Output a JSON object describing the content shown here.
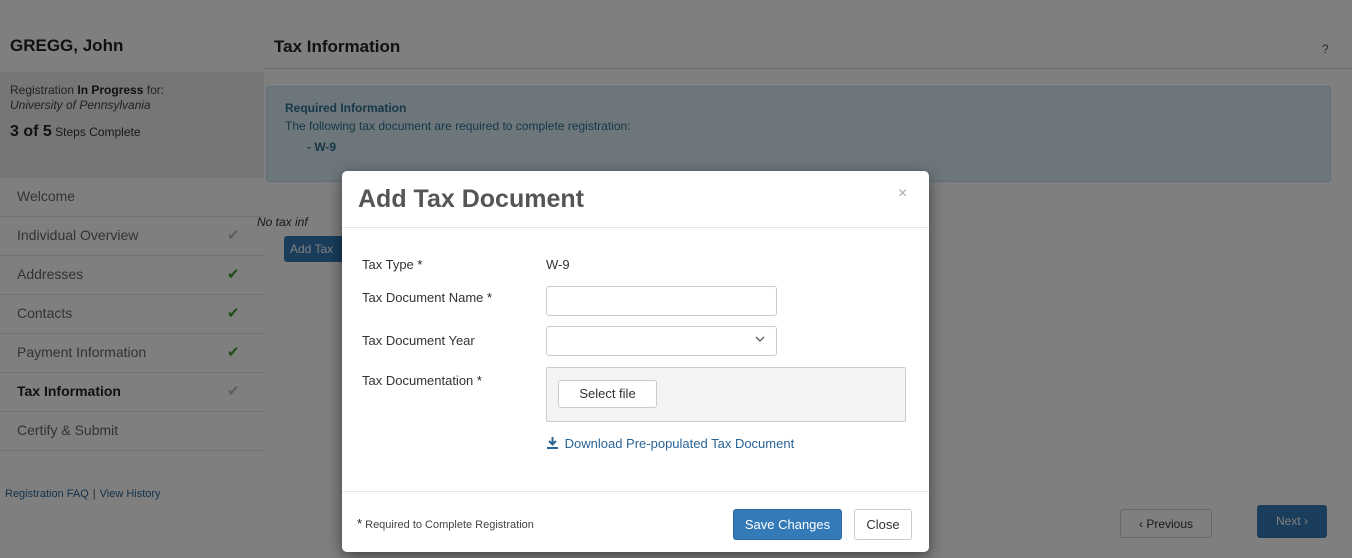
{
  "sidebar": {
    "user_name": "GREGG, John",
    "status_prefix": "Registration ",
    "status_bold": "In Progress",
    "status_suffix": " for:",
    "organization": "University of Pennsylvania",
    "progress_big": "3 of 5",
    "progress_small": " Steps Complete",
    "steps": [
      {
        "label": "Welcome",
        "check": ""
      },
      {
        "label": "Individual Overview",
        "check": "✔"
      },
      {
        "label": "Addresses",
        "check": "✔"
      },
      {
        "label": "Contacts",
        "check": "✔"
      },
      {
        "label": "Payment Information",
        "check": "✔"
      },
      {
        "label": "Tax Information",
        "check": "✔"
      },
      {
        "label": "Certify & Submit",
        "check": ""
      }
    ],
    "link_faq": "Registration FAQ",
    "link_sep": "|",
    "link_history": "View History"
  },
  "main": {
    "title": "Tax Information",
    "help": "?",
    "alert_heading": "Required Information",
    "alert_text": "The following tax document are required to complete registration:",
    "alert_item": "-   W-9",
    "no_tax_text": "No tax inf",
    "add_tax_label": "Add Tax",
    "prev_label": "‹ Previous",
    "next_label": "Next ›"
  },
  "modal": {
    "title": "Add Tax Document",
    "close_x": "×",
    "fields": {
      "tax_type_label": "Tax Type",
      "tax_type_value": "W-9",
      "doc_name_label": "Tax Document Name",
      "doc_name_value": "",
      "doc_year_label": "Tax Document Year",
      "doc_year_value": "",
      "documentation_label": "Tax Documentation",
      "select_file_label": "Select file",
      "download_link": "Download Pre-populated Tax Document"
    },
    "required_star": "*",
    "footer_note": "Required to Complete Registration",
    "save_label": "Save Changes",
    "close_label": "Close"
  },
  "colors": {
    "primary": "#337ab7",
    "check_green": "#3c9a2c",
    "alert_bg": "#d9edf7",
    "link": "#2a6496"
  }
}
